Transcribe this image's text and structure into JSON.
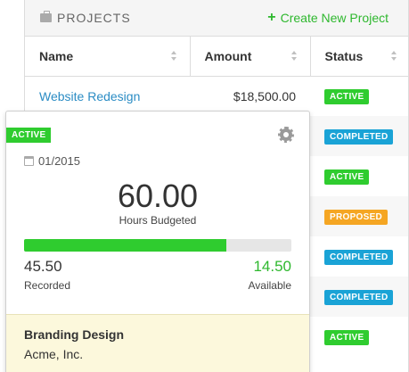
{
  "panel": {
    "title": "PROJECTS",
    "create_label": "Create New Project",
    "title_icon": "briefcase-icon",
    "create_icon": "plus-icon"
  },
  "table": {
    "columns": [
      "Name",
      "Amount",
      "Status"
    ],
    "rows": [
      {
        "name": "Website Redesign",
        "amount": "$18,500.00",
        "status": "ACTIVE",
        "status_color": "#2fcc2f"
      },
      {
        "name": "",
        "amount": "",
        "status": "COMPLETED",
        "status_color": "#1aa3d6"
      },
      {
        "name": "",
        "amount": "",
        "status": "ACTIVE",
        "status_color": "#2fcc2f"
      },
      {
        "name": "",
        "amount": "",
        "status": "PROPOSED",
        "status_color": "#f5a623"
      },
      {
        "name": "",
        "amount": "",
        "status": "COMPLETED",
        "status_color": "#1aa3d6"
      },
      {
        "name": "",
        "amount": "",
        "status": "COMPLETED",
        "status_color": "#1aa3d6"
      },
      {
        "name": "",
        "amount": "",
        "status": "ACTIVE",
        "status_color": "#2fcc2f"
      }
    ]
  },
  "card": {
    "status": "ACTIVE",
    "date": "01/2015",
    "hours_budgeted": "60.00",
    "hours_budgeted_label": "Hours Budgeted",
    "progress_fraction": 0.758,
    "recorded": "45.50",
    "recorded_label": "Recorded",
    "available": "14.50",
    "available_label": "Available",
    "project_name": "Branding Design",
    "client_name": "Acme, Inc."
  },
  "colors": {
    "active": "#2fcc2f",
    "completed": "#1aa3d6",
    "proposed": "#f5a623",
    "link": "#2b8cc4",
    "footer_bg": "#fcf8dc"
  }
}
